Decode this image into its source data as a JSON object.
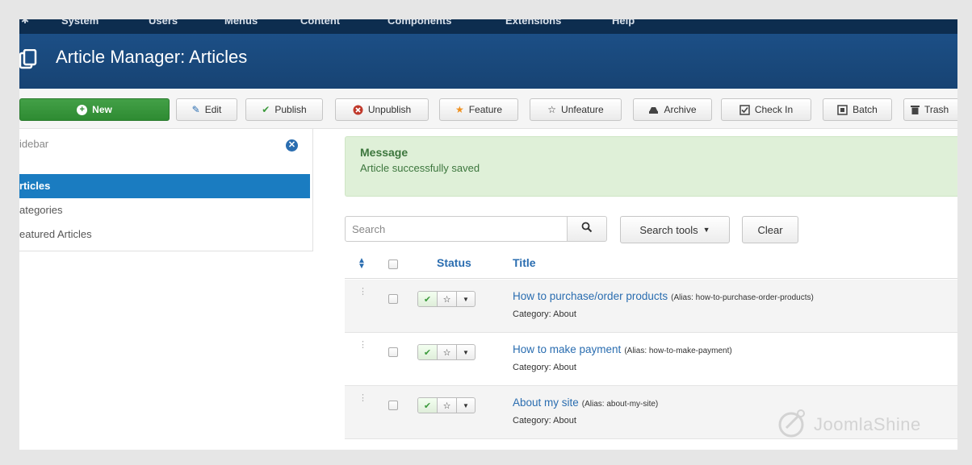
{
  "topnav": {
    "items": [
      "System",
      "Users",
      "Menus",
      "Content",
      "Components",
      "Extensions",
      "Help"
    ]
  },
  "header": {
    "title": "Article Manager: Articles"
  },
  "toolbar": {
    "new": "New",
    "edit": "Edit",
    "publish": "Publish",
    "unpublish": "Unpublish",
    "feature": "Feature",
    "unfeature": "Unfeature",
    "archive": "Archive",
    "checkin": "Check In",
    "batch": "Batch",
    "trash": "Trash"
  },
  "sidebar": {
    "title": "idebar",
    "items": [
      {
        "label": "rticles",
        "active": true
      },
      {
        "label": "ategories",
        "active": false
      },
      {
        "label": "eatured Articles",
        "active": false
      }
    ]
  },
  "message": {
    "title": "Message",
    "text": "Article successfully saved"
  },
  "search": {
    "placeholder": "Search",
    "tools_label": "Search tools",
    "clear_label": "Clear"
  },
  "table": {
    "headers": {
      "status": "Status",
      "title": "Title"
    },
    "rows": [
      {
        "title": "How to purchase/order products",
        "alias": "(Alias: how-to-purchase-order-products)",
        "category": "Category: About"
      },
      {
        "title": "How to make payment",
        "alias": "(Alias: how-to-make-payment)",
        "category": "Category: About"
      },
      {
        "title": "About my site",
        "alias": "(Alias: about-my-site)",
        "category": "Category: About"
      }
    ]
  },
  "watermark": {
    "text": "JoomlaShine"
  },
  "colors": {
    "header_blue": "#1c4f86",
    "new_green": "#2e8b32",
    "active_blue": "#1a7cc1",
    "message_bg": "#dff0d8",
    "link_blue": "#2a6db0"
  }
}
